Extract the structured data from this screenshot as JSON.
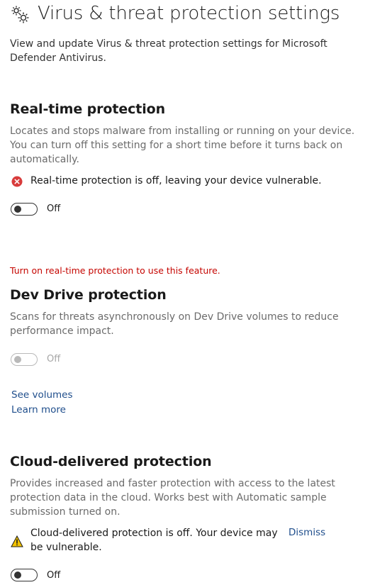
{
  "header": {
    "title": "Virus & threat protection settings",
    "description": "View and update Virus & threat protection settings for Microsoft Defender Antivirus."
  },
  "realtime": {
    "title": "Real-time protection",
    "description": "Locates and stops malware from installing or running on your device. You can turn off this setting for a short time before it turns back on automatically.",
    "status": "Real-time protection is off, leaving your device vulnerable.",
    "toggle_label": "Off",
    "enabled": false
  },
  "dev_drive": {
    "warning": "Turn on real-time protection to use this feature.",
    "title": "Dev Drive protection",
    "description": "Scans for threats asynchronously on Dev Drive volumes to reduce performance impact.",
    "toggle_label": "Off",
    "enabled": false,
    "disabled": true,
    "links": {
      "see_volumes": "See volumes",
      "learn_more": "Learn more"
    }
  },
  "cloud": {
    "title": "Cloud-delivered protection",
    "description": "Provides increased and faster protection with access to the latest protection data in the cloud. Works best with Automatic sample submission turned on.",
    "status": "Cloud-delivered protection is off. Your device may be vulnerable.",
    "dismiss_label": "Dismiss",
    "toggle_label": "Off",
    "enabled": false
  },
  "colors": {
    "error": "#c50500",
    "error_icon": "#d83b3b",
    "warning_icon": "#f2c200",
    "link": "#1f4e8c"
  },
  "icons": {
    "header": "gears-icon",
    "realtime_status": "error-icon",
    "cloud_status": "warning-icon"
  }
}
